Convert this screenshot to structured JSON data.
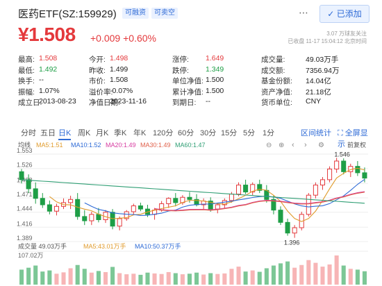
{
  "header": {
    "title": "医药ETF(SZ:159929)",
    "tags": [
      "可融资",
      "可卖空"
    ],
    "add_label": "已添加"
  },
  "quote": {
    "price": "¥1.508",
    "change": "+0.009",
    "change_pct": "+0.60%",
    "status_line1": "3.07 万球友关注",
    "status_line2": "已收盘 11-17 15:04:12 北京时间"
  },
  "stats": [
    [
      {
        "k": "最高:",
        "v": "1.508",
        "c": "red"
      },
      {
        "k": "今开:",
        "v": "1.498",
        "c": "red"
      },
      {
        "k": "涨停:",
        "v": "1.649",
        "c": "red"
      },
      {
        "k": "成交量:",
        "v": "49.03万手",
        "c": "dark"
      }
    ],
    [
      {
        "k": "最低:",
        "v": "1.492",
        "c": "green"
      },
      {
        "k": "昨收:",
        "v": "1.499",
        "c": "dark"
      },
      {
        "k": "跌停:",
        "v": "1.349",
        "c": "green"
      },
      {
        "k": "成交额:",
        "v": "7356.94万",
        "c": "dark"
      }
    ],
    [
      {
        "k": "换手:",
        "v": "--",
        "c": "dark"
      },
      {
        "k": "市价:",
        "v": "1.508",
        "c": "dark"
      },
      {
        "k": "单位净值:",
        "v": "1.500",
        "c": "dark"
      },
      {
        "k": "基金份额:",
        "v": "14.04亿",
        "c": "dark"
      }
    ],
    [
      {
        "k": "振幅:",
        "v": "1.07%",
        "c": "dark"
      },
      {
        "k": "溢价率:",
        "v": "-0.07%",
        "c": "dark"
      },
      {
        "k": "累计净值:",
        "v": "1.500",
        "c": "dark"
      },
      {
        "k": "资产净值:",
        "v": "21.18亿",
        "c": "dark"
      }
    ],
    [
      {
        "k": "成立日:",
        "v": "2013-08-23",
        "c": "dark"
      },
      {
        "k": "净值日期:",
        "v": "2023-11-16",
        "c": "dark"
      },
      {
        "k": "到期日:",
        "v": "--",
        "c": "dark"
      },
      {
        "k": "货币单位:",
        "v": "CNY",
        "c": "dark"
      }
    ]
  ],
  "tabs": [
    "分时",
    "五日",
    "日K",
    "周K",
    "月K",
    "季K",
    "年K",
    "120分",
    "60分",
    "30分",
    "15分",
    "5分",
    "1分"
  ],
  "active_tab": "日K",
  "links": {
    "stats": "区间统计",
    "fullscreen": "全屏显示"
  },
  "ma_legend": {
    "label": "均线",
    "items": [
      {
        "name": "MA5:1.51",
        "color": "#e09b2c"
      },
      {
        "name": "MA10:1.52",
        "color": "#2d6ad6"
      },
      {
        "name": "MA20:1.49",
        "color": "#d63aa0"
      },
      {
        "name": "MA30:1.49",
        "color": "#e0604a"
      },
      {
        "name": "MA60:1.47",
        "color": "#2f9e74"
      }
    ],
    "adjust": "前复权"
  },
  "chart_axis": {
    "y": [
      "1.553",
      "1.526",
      "1.498",
      "1.471",
      "1.444",
      "1.416",
      "1.389"
    ],
    "high_mark": "1.546",
    "low_mark": "1.396"
  },
  "volume_legend": {
    "label": "成交量 49.03万手",
    "items": [
      {
        "name": "MA5:43.01万手",
        "color": "#e09b2c"
      },
      {
        "name": "MA10:50.37万手",
        "color": "#2d6ad6"
      }
    ],
    "top": "107.02万"
  },
  "chart_data": {
    "type": "candlestick",
    "candles": [
      [
        1.52,
        1.525,
        1.498,
        1.505
      ],
      [
        1.505,
        1.515,
        1.48,
        1.488
      ],
      [
        1.488,
        1.5,
        1.46,
        1.47
      ],
      [
        1.47,
        1.48,
        1.452,
        1.458
      ],
      [
        1.458,
        1.466,
        1.44,
        1.446
      ],
      [
        1.446,
        1.46,
        1.438,
        1.455
      ],
      [
        1.455,
        1.47,
        1.45,
        1.462
      ],
      [
        1.462,
        1.475,
        1.45,
        1.468
      ],
      [
        1.468,
        1.48,
        1.43,
        1.436
      ],
      [
        1.436,
        1.448,
        1.42,
        1.428
      ],
      [
        1.428,
        1.445,
        1.42,
        1.44
      ],
      [
        1.44,
        1.452,
        1.425,
        1.43
      ],
      [
        1.43,
        1.448,
        1.424,
        1.444
      ],
      [
        1.444,
        1.45,
        1.412,
        1.418
      ],
      [
        1.418,
        1.436,
        1.41,
        1.432
      ],
      [
        1.432,
        1.448,
        1.428,
        1.445
      ],
      [
        1.445,
        1.46,
        1.44,
        1.456
      ],
      [
        1.456,
        1.462,
        1.446,
        1.45
      ],
      [
        1.45,
        1.458,
        1.435,
        1.44
      ],
      [
        1.44,
        1.452,
        1.43,
        1.448
      ],
      [
        1.448,
        1.465,
        1.445,
        1.46
      ],
      [
        1.46,
        1.472,
        1.452,
        1.47
      ],
      [
        1.47,
        1.48,
        1.455,
        1.462
      ],
      [
        1.462,
        1.476,
        1.458,
        1.472
      ],
      [
        1.472,
        1.482,
        1.462,
        1.468
      ],
      [
        1.468,
        1.478,
        1.455,
        1.458
      ],
      [
        1.458,
        1.47,
        1.45,
        1.465
      ],
      [
        1.465,
        1.472,
        1.445,
        1.45
      ],
      [
        1.45,
        1.462,
        1.442,
        1.458
      ],
      [
        1.458,
        1.47,
        1.452,
        1.466
      ],
      [
        1.466,
        1.482,
        1.462,
        1.478
      ],
      [
        1.478,
        1.5,
        1.474,
        1.495
      ],
      [
        1.495,
        1.505,
        1.478,
        1.482
      ],
      [
        1.482,
        1.5,
        1.476,
        1.496
      ],
      [
        1.496,
        1.505,
        1.48,
        1.485
      ],
      [
        1.485,
        1.495,
        1.462,
        1.468
      ],
      [
        1.468,
        1.476,
        1.44,
        1.448
      ],
      [
        1.448,
        1.455,
        1.42,
        1.425
      ],
      [
        1.425,
        1.432,
        1.4,
        1.405
      ],
      [
        1.405,
        1.42,
        1.396,
        1.415
      ],
      [
        1.415,
        1.445,
        1.41,
        1.44
      ],
      [
        1.44,
        1.48,
        1.436,
        1.476
      ],
      [
        1.476,
        1.5,
        1.47,
        1.495
      ],
      [
        1.495,
        1.51,
        1.486,
        1.505
      ],
      [
        1.505,
        1.53,
        1.5,
        1.525
      ],
      [
        1.525,
        1.546,
        1.518,
        1.54
      ],
      [
        1.54,
        1.545,
        1.515,
        1.52
      ],
      [
        1.52,
        1.535,
        1.51,
        1.53
      ],
      [
        1.53,
        1.54,
        1.512,
        1.518
      ],
      [
        1.518,
        1.528,
        1.5,
        1.508
      ]
    ],
    "volume": [
      55,
      62,
      70,
      48,
      52,
      40,
      45,
      60,
      72,
      58,
      44,
      50,
      46,
      65,
      42,
      38,
      40,
      36,
      44,
      41,
      39,
      46,
      42,
      38,
      40,
      44,
      37,
      42,
      39,
      41,
      58,
      66,
      48,
      52,
      47,
      60,
      70,
      78,
      85,
      62,
      72,
      90,
      80,
      66,
      74,
      107,
      70,
      58,
      55,
      49
    ]
  }
}
